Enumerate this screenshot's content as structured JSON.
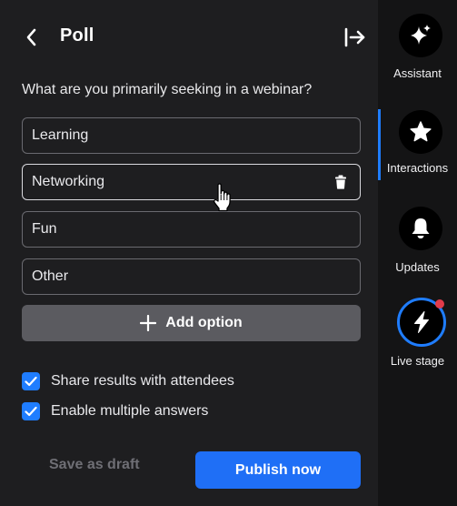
{
  "header": {
    "title": "Poll"
  },
  "poll": {
    "question": "What are you primarily seeking in a webinar?",
    "options": [
      {
        "label": "Learning"
      },
      {
        "label": "Networking"
      },
      {
        "label": "Fun"
      },
      {
        "label": "Other"
      }
    ],
    "add_option_label": "Add option",
    "settings": [
      {
        "label": "Share results with attendees",
        "checked": true
      },
      {
        "label": "Enable multiple answers",
        "checked": true
      }
    ],
    "save_draft_label": "Save as draft",
    "publish_label": "Publish now"
  },
  "rail": {
    "items": [
      {
        "label": "Assistant",
        "icon": "sparkle-icon"
      },
      {
        "label": "Interactions",
        "icon": "star-icon"
      },
      {
        "label": "Updates",
        "icon": "bell-icon"
      },
      {
        "label": "Live stage",
        "icon": "lightning-icon"
      }
    ],
    "active_item": "Interactions"
  },
  "colors": {
    "accent": "#1f6ff6",
    "panel_bg": "#1e1e20",
    "rail_bg": "#141415",
    "notification_dot": "#e23b4a"
  }
}
